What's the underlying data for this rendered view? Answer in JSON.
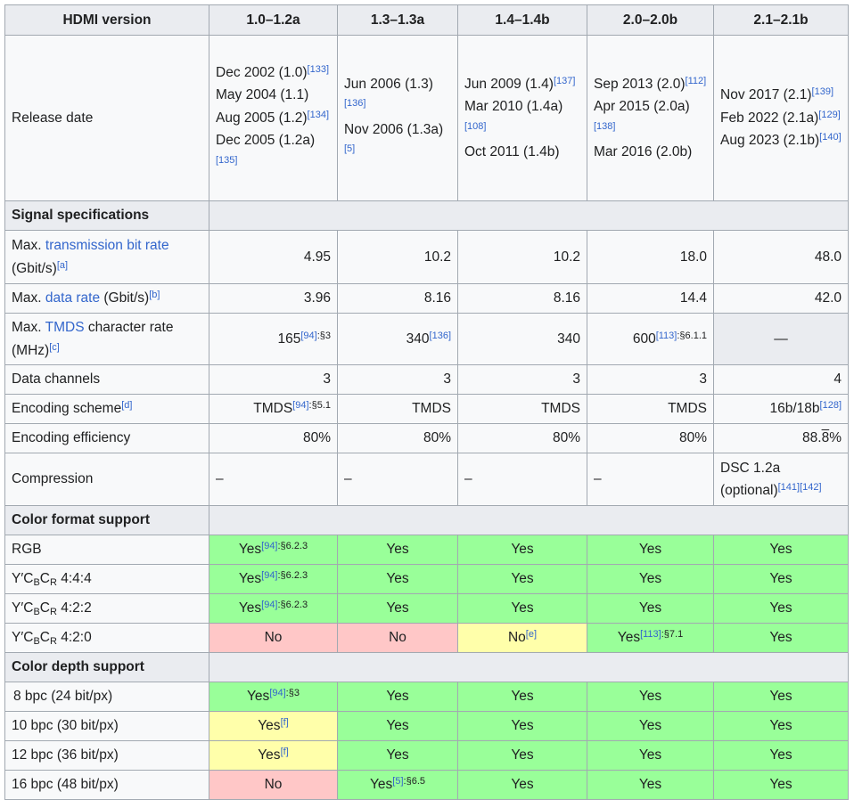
{
  "header": {
    "col0": "HDMI version",
    "col1": "1.0–1.2a",
    "col2": "1.3–1.3a",
    "col3": "1.4–1.4b",
    "col4": "2.0–2.0b",
    "col5": "2.1–2.1b"
  },
  "release": {
    "label": "Release date",
    "c1": [
      {
        "text": "Dec 2002 (1.0)",
        "ref": "[133]"
      },
      {
        "text": "May 2004 (1.1)",
        "ref": ""
      },
      {
        "text": "Aug 2005 (1.2)",
        "ref": "[134]"
      },
      {
        "text": "Dec 2005 (1.2a)",
        "ref": "[135]"
      }
    ],
    "c2": [
      {
        "text": "Jun 2006 (1.3)",
        "ref": "[136]"
      },
      {
        "text": "Nov 2006 (1.3a)",
        "ref": "[5]"
      }
    ],
    "c3": [
      {
        "text": "Jun 2009 (1.4)",
        "ref": "[137]"
      },
      {
        "text": "Mar 2010 (1.4a)",
        "ref": "[108]"
      },
      {
        "text": "Oct 2011 (1.4b)",
        "ref": ""
      }
    ],
    "c4": [
      {
        "text": "Sep 2013 (2.0)",
        "ref": "[112]"
      },
      {
        "text": "Apr 2015 (2.0a)",
        "ref": "[138]"
      },
      {
        "text": "Mar 2016 (2.0b)",
        "ref": ""
      }
    ],
    "c5": [
      {
        "text": "Nov 2017 (2.1)",
        "ref": "[139]"
      },
      {
        "text": "Feb 2022 (2.1a)",
        "ref": "[129]"
      },
      {
        "text": "Aug 2023 (2.1b)",
        "ref": "[140]"
      }
    ]
  },
  "sections": {
    "signal": "Signal specifications",
    "color_format": "Color format support",
    "color_depth": "Color depth support"
  },
  "signal": {
    "bitrate": {
      "label_pre": "Max. ",
      "label_link": "transmission bit rate",
      "label_post": " (Gbit/s)",
      "note": "[a]",
      "values": [
        "4.95",
        "10.2",
        "10.2",
        "18.0",
        "48.0"
      ]
    },
    "datarate": {
      "label_pre": "Max. ",
      "label_link": "data rate",
      "label_post": " (Gbit/s)",
      "note": "[b]",
      "values": [
        "3.96",
        "8.16",
        "8.16",
        "14.4",
        "42.0"
      ]
    },
    "tmds": {
      "label_pre": "Max. ",
      "label_link": "TMDS",
      "label_post": " character rate (MHz)",
      "note": "[c]",
      "c1": {
        "text": "165",
        "ref": "[94]",
        "page": ":§3"
      },
      "c2": {
        "text": "340",
        "ref": "[136]"
      },
      "c3": "340",
      "c4": {
        "text": "600",
        "ref": "[113]",
        "page": ":§6.1.1"
      },
      "c5": "—"
    },
    "channels": {
      "label": "Data channels",
      "values": [
        "3",
        "3",
        "3",
        "3",
        "4"
      ]
    },
    "encoding": {
      "label": "Encoding scheme",
      "note": "[d]",
      "c1": {
        "text": "TMDS",
        "ref": "[94]",
        "page": ":§5.1"
      },
      "c2": "TMDS",
      "c3": "TMDS",
      "c4": "TMDS",
      "c5": {
        "text": "16b/18b",
        "ref": "[128]"
      }
    },
    "efficiency": {
      "label": "Encoding efficiency",
      "values": [
        "80%",
        "80%",
        "80%",
        "80%"
      ],
      "c5_pre": "88.",
      "c5_over": "8",
      "c5_post": "%"
    },
    "compression": {
      "label": "Compression",
      "values": [
        "–",
        "–",
        "–",
        "–"
      ],
      "c5_line1": "DSC 1.2a",
      "c5_line2": "(optional)",
      "c5_refs": "[141][142]"
    }
  },
  "color_format": [
    {
      "label": "RGB",
      "cells": [
        {
          "text": "Yes",
          "ref": "[94]",
          "page": ":§6.2.3",
          "status": "yes"
        },
        {
          "text": "Yes",
          "status": "yes"
        },
        {
          "text": "Yes",
          "status": "yes"
        },
        {
          "text": "Yes",
          "status": "yes"
        },
        {
          "text": "Yes",
          "status": "yes"
        }
      ]
    },
    {
      "label_pre": "Y′C",
      "sub1": "B",
      "mid": "C",
      "sub2": "R",
      "label_post": " 4:4:4",
      "cells": [
        {
          "text": "Yes",
          "ref": "[94]",
          "page": ":§6.2.3",
          "status": "yes"
        },
        {
          "text": "Yes",
          "status": "yes"
        },
        {
          "text": "Yes",
          "status": "yes"
        },
        {
          "text": "Yes",
          "status": "yes"
        },
        {
          "text": "Yes",
          "status": "yes"
        }
      ]
    },
    {
      "label_pre": "Y′C",
      "sub1": "B",
      "mid": "C",
      "sub2": "R",
      "label_post": " 4:2:2",
      "cells": [
        {
          "text": "Yes",
          "ref": "[94]",
          "page": ":§6.2.3",
          "status": "yes"
        },
        {
          "text": "Yes",
          "status": "yes"
        },
        {
          "text": "Yes",
          "status": "yes"
        },
        {
          "text": "Yes",
          "status": "yes"
        },
        {
          "text": "Yes",
          "status": "yes"
        }
      ]
    },
    {
      "label_pre": "Y′C",
      "sub1": "B",
      "mid": "C",
      "sub2": "R",
      "label_post": " 4:2:0",
      "cells": [
        {
          "text": "No",
          "status": "no"
        },
        {
          "text": "No",
          "status": "no"
        },
        {
          "text": "No",
          "ref": "[e]",
          "status": "partial"
        },
        {
          "text": "Yes",
          "ref": "[113]",
          "page": ":§7.1",
          "status": "yes"
        },
        {
          "text": "Yes",
          "status": "yes"
        }
      ]
    }
  ],
  "color_depth": [
    {
      "label": "8 bpc (24 bit/px)",
      "cells": [
        {
          "text": "Yes",
          "ref": "[94]",
          "page": ":§3",
          "status": "yes"
        },
        {
          "text": "Yes",
          "status": "yes"
        },
        {
          "text": "Yes",
          "status": "yes"
        },
        {
          "text": "Yes",
          "status": "yes"
        },
        {
          "text": "Yes",
          "status": "yes"
        }
      ]
    },
    {
      "label": "10 bpc (30 bit/px)",
      "cells": [
        {
          "text": "Yes",
          "ref": "[f]",
          "status": "partial"
        },
        {
          "text": "Yes",
          "status": "yes"
        },
        {
          "text": "Yes",
          "status": "yes"
        },
        {
          "text": "Yes",
          "status": "yes"
        },
        {
          "text": "Yes",
          "status": "yes"
        }
      ]
    },
    {
      "label": "12 bpc (36 bit/px)",
      "cells": [
        {
          "text": "Yes",
          "ref": "[f]",
          "status": "partial"
        },
        {
          "text": "Yes",
          "status": "yes"
        },
        {
          "text": "Yes",
          "status": "yes"
        },
        {
          "text": "Yes",
          "status": "yes"
        },
        {
          "text": "Yes",
          "status": "yes"
        }
      ]
    },
    {
      "label": "16 bpc (48 bit/px)",
      "cells": [
        {
          "text": "No",
          "status": "no"
        },
        {
          "text": "Yes",
          "ref": "[5]",
          "page": ":§6.5",
          "status": "yes"
        },
        {
          "text": "Yes",
          "status": "yes"
        },
        {
          "text": "Yes",
          "status": "yes"
        },
        {
          "text": "Yes",
          "status": "yes"
        }
      ]
    }
  ],
  "colors": {
    "yes": "#99ff99",
    "no": "#ffc7c7",
    "partial": "#ffffaa",
    "header": "#eaecf0",
    "link": "#3366cc"
  }
}
